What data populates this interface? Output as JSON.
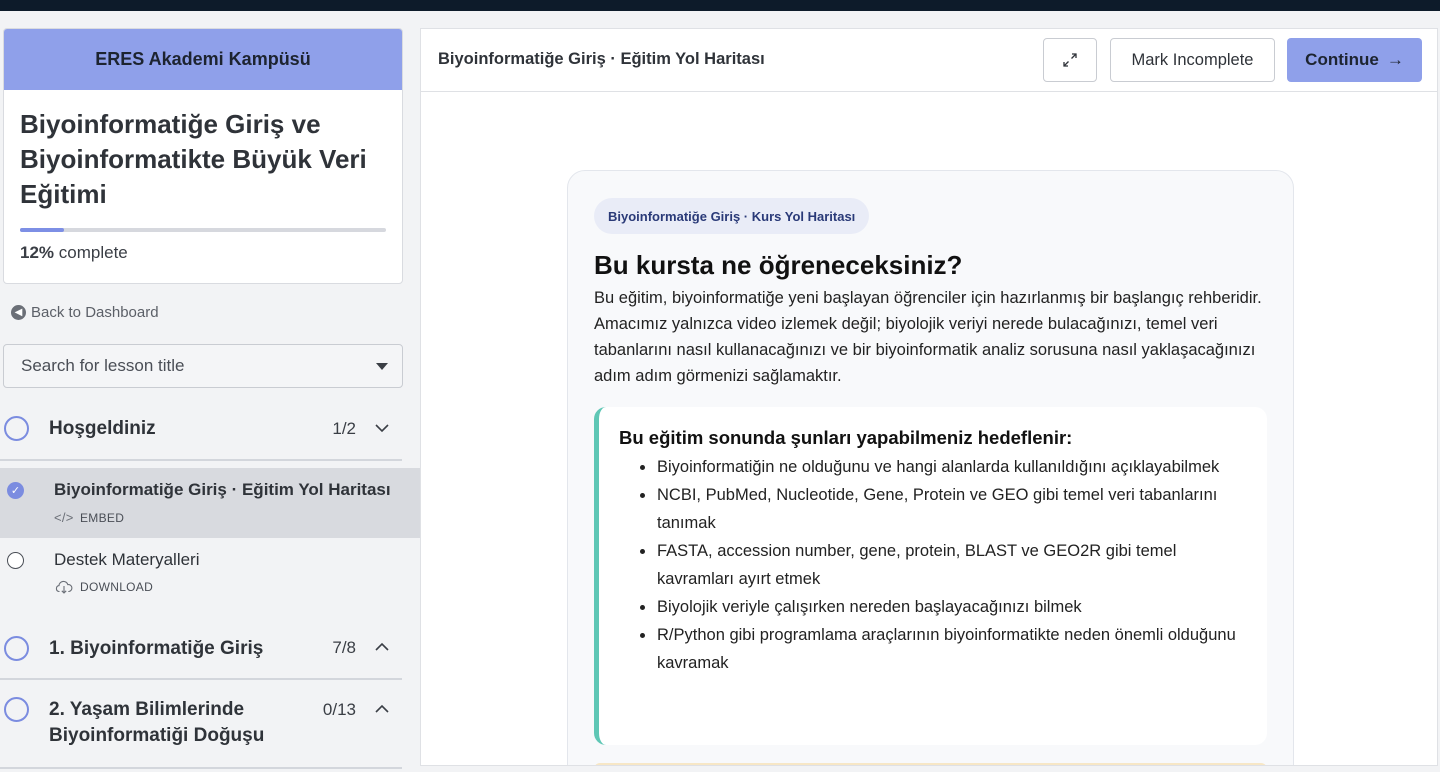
{
  "sidebar": {
    "campus_name": "ERES Akademi Kampüsü",
    "course_title": "Biyoinformatiğe Giriş ve Biyoinformatikte Büyük Veri Eğitimi",
    "progress_percent": "12%",
    "progress_value": 0.12,
    "progress_suffix": "complete",
    "back_label": "Back to Dashboard",
    "search_placeholder": "Search for lesson title",
    "sections": [
      {
        "title": "Hoşgeldiniz",
        "count": "1/2",
        "expanded": true,
        "lessons": [
          {
            "title": "Biyoinformatiğe Giriş · Eğitim Yol Haritası",
            "type": "EMBED",
            "type_icon": "code-icon",
            "completed": true,
            "active": true
          },
          {
            "title": "Destek Materyalleri",
            "type": "DOWNLOAD",
            "type_icon": "cloud-download-icon",
            "completed": false,
            "active": false
          }
        ]
      },
      {
        "title": "1. Biyoinformatiğe Giriş",
        "count": "7/8",
        "expanded": false
      },
      {
        "title": "2. Yaşam Bilimlerinde Biyoinformatiği Doğuşu",
        "count": "0/13",
        "expanded": false
      }
    ]
  },
  "main": {
    "title": "Biyoinformatiğe Giriş · Eğitim Yol Haritası",
    "expand_icon": "expand-icon",
    "mark_incomplete_label": "Mark Incomplete",
    "continue_label": "Continue",
    "continue_arrow": "→",
    "content": {
      "pill": "Biyoinformatiğe Giriş · Kurs Yol Haritası",
      "heading": "Bu kursta ne öğreneceksiniz?",
      "intro": "Bu eğitim, biyoinformatiğe yeni başlayan öğrenciler için hazırlanmış bir başlangıç rehberidir. Amacımız yalnızca video izlemek değil; biyolojik veriyi nerede bulacağınızı, temel veri tabanlarını nasıl kullanacağınızı ve bir biyoinformatik analiz sorusuna nasıl yaklaşacağınızı adım adım görmenizi sağlamaktır.",
      "goals_title": "Bu eğitim sonunda şunları yapabilmeniz hedeflenir:",
      "goals": [
        "Biyoinformatiğin ne olduğunu ve hangi alanlarda kullanıldığını açıklayabilmek",
        "NCBI, PubMed, Nucleotide, Gene, Protein ve GEO gibi temel veri tabanlarını tanımak",
        "FASTA, accession number, gene, protein, BLAST ve GEO2R gibi temel kavramları ayırt etmek",
        "Biyolojik veriyle çalışırken nereden başlayacağınızı bilmek",
        "R/Python gibi programlama araçlarının biyoinformatikte neden önemli olduğunu kavramak"
      ]
    }
  },
  "colors": {
    "accent": "#8fa0ea",
    "goals_border": "#5fc7b5",
    "topbar": "#0d1b2a"
  }
}
